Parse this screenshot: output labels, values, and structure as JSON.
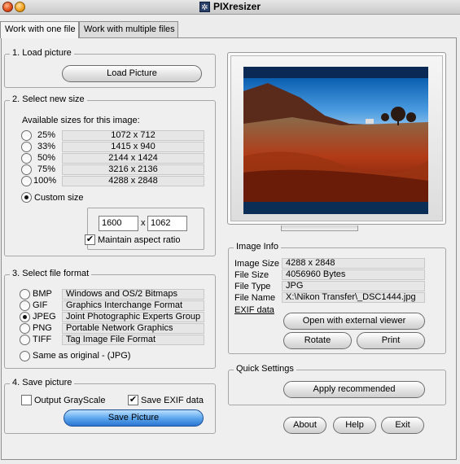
{
  "window": {
    "title": "PIXresizer"
  },
  "tabs": [
    {
      "label": "Work with one file",
      "active": true
    },
    {
      "label": "Work with multiple files",
      "active": false
    }
  ],
  "load": {
    "legend": "1. Load picture",
    "button": "Load Picture"
  },
  "size": {
    "legend": "2. Select new size",
    "available_label": "Available sizes for this image:",
    "options": [
      {
        "percent": "25%",
        "dims": "1072 x 712"
      },
      {
        "percent": "33%",
        "dims": "1415 x 940"
      },
      {
        "percent": "50%",
        "dims": "2144 x 1424"
      },
      {
        "percent": "75%",
        "dims": "3216 x 2136"
      },
      {
        "percent": "100%",
        "dims": "4288 x 2848"
      }
    ],
    "custom_label": "Custom size",
    "custom_selected": true,
    "width": "1600",
    "x": "x",
    "height": "1062",
    "maintain_label": "Maintain aspect ratio",
    "maintain_checked": true
  },
  "format": {
    "legend": "3. Select file format",
    "options": [
      {
        "name": "BMP",
        "desc": "Windows and OS/2 Bitmaps"
      },
      {
        "name": "GIF",
        "desc": "Graphics Interchange Format"
      },
      {
        "name": "JPEG",
        "desc": "Joint Photographic Experts Group"
      },
      {
        "name": "PNG",
        "desc": "Portable Network Graphics"
      },
      {
        "name": "TIFF",
        "desc": "Tag Image File Format"
      }
    ],
    "selected": "JPEG",
    "same_label": "Same as original - (JPG)"
  },
  "save": {
    "legend": "4. Save picture",
    "grayscale_label": "Output GrayScale",
    "grayscale_checked": false,
    "exif_label": "Save EXIF data",
    "exif_checked": true,
    "button": "Save Picture"
  },
  "info": {
    "legend": "Image Info",
    "rows": [
      {
        "label": "Image Size",
        "value": "4288 x 2848"
      },
      {
        "label": "File Size",
        "value": "4056960 Bytes"
      },
      {
        "label": "File Type",
        "value": "JPG"
      },
      {
        "label": "File Name",
        "value": "X:\\Nikon Transfer\\_DSC1444.jpg"
      }
    ],
    "exif_link": "EXIF data",
    "open_external": "Open with external viewer",
    "rotate": "Rotate",
    "print": "Print"
  },
  "quick": {
    "legend": "Quick Settings",
    "apply": "Apply recommended"
  },
  "footer": {
    "about": "About",
    "help": "Help",
    "exit": "Exit"
  }
}
